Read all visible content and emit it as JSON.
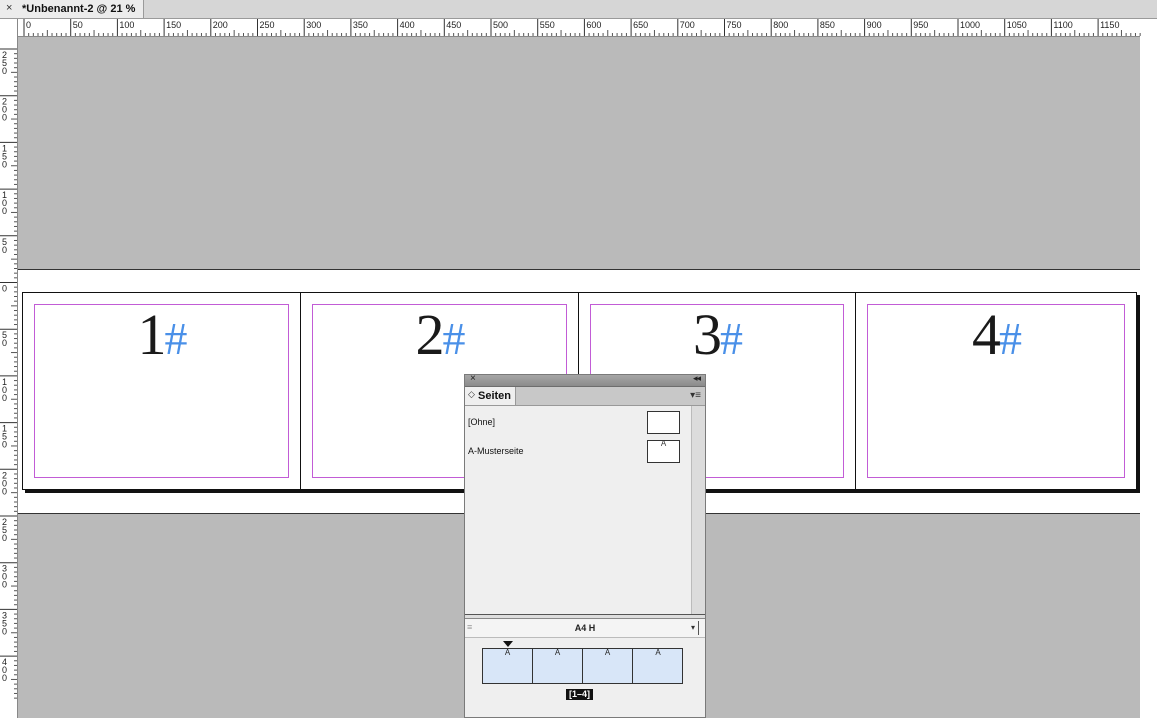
{
  "document_tab": {
    "close_glyph": "×",
    "title": "*Unbenannt-2 @ 21 %"
  },
  "ruler": {
    "top_labels": [
      "0",
      "50",
      "100",
      "150",
      "200",
      "250",
      "300",
      "350",
      "400",
      "450",
      "500",
      "550",
      "600",
      "650",
      "700",
      "750",
      "800",
      "850",
      "900",
      "950",
      "1000",
      "1050",
      "1100",
      "1150"
    ],
    "left_labels": [
      "2 5 0",
      "2 0 0",
      "1 5 0",
      "1 0 0",
      "5 0",
      "0",
      "5 0",
      "1 0 0",
      "1 5 0",
      "2 0 0",
      "2 5 0",
      "3 0 0",
      "3 5 0",
      "4 0 0"
    ]
  },
  "spread": {
    "pages": [
      {
        "number": "1",
        "marker": "#"
      },
      {
        "number": "2",
        "marker": "#"
      },
      {
        "number": "3",
        "marker": "#"
      },
      {
        "number": "4",
        "marker": "#"
      }
    ]
  },
  "pages_panel": {
    "close_glyph": "×",
    "collapse_glyph": "◂◂",
    "tab_arrow": "◇",
    "tab_label": "Seiten",
    "menu_glyph": "▾≡",
    "masters": [
      {
        "label": "[Ohne]",
        "badge": ""
      },
      {
        "label": "A-Musterseite",
        "badge": "A"
      }
    ],
    "size_grip": "≡",
    "size_label": "A4 H",
    "size_dropdown": "▾",
    "page_thumbs": [
      {
        "badge": "A"
      },
      {
        "badge": "A"
      },
      {
        "badge": "A"
      },
      {
        "badge": "A"
      }
    ],
    "spread_range": "[1–4]"
  },
  "colors": {
    "pasteboard": "#bababa",
    "margin_guide": "#c25cd6",
    "page_marker": "#4a90e8",
    "thumb_fill": "#d8e6f8"
  }
}
